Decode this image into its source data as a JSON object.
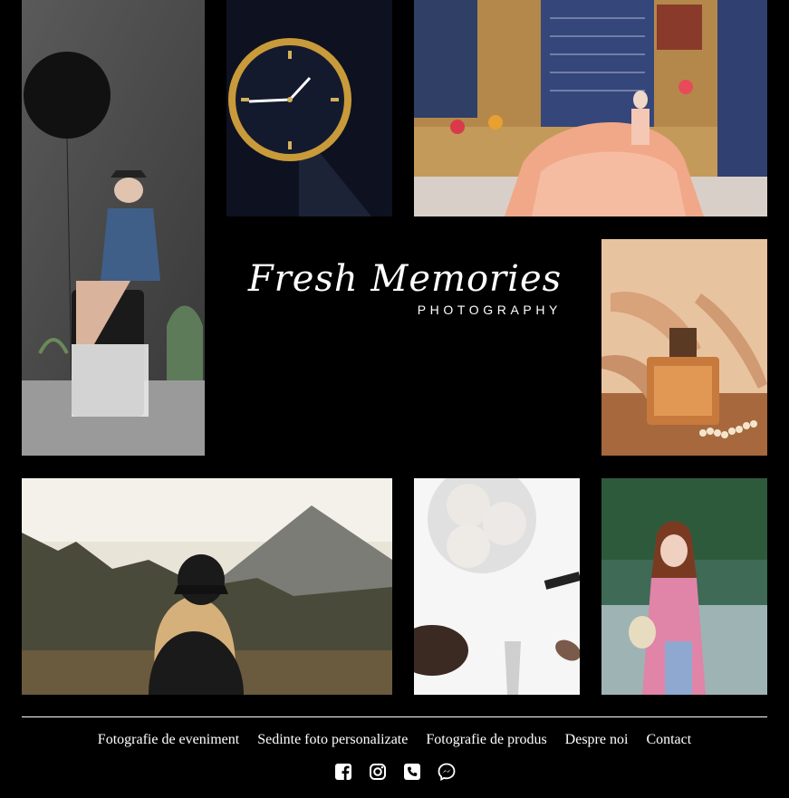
{
  "brand": {
    "name": "Fresh Memories",
    "tagline": "PHOTOGRAPHY"
  },
  "gallery": [
    {
      "subject": "woman with black balloon sitting on stool"
    },
    {
      "subject": "gold wristwatch"
    },
    {
      "subject": "bride in peach ball gown"
    },
    {
      "subject": "perfume bottle with heels and pearls"
    },
    {
      "subject": "woman in cap facing mountains"
    },
    {
      "subject": "makeup brushes and powder"
    },
    {
      "subject": "woman in pink ao dai by lake"
    }
  ],
  "footer": {
    "nav": [
      "Fotografie de eveniment",
      "Sedinte foto personalizate",
      "Fotografie de produs",
      "Despre noi",
      "Contact"
    ],
    "social_icons": [
      "facebook-icon",
      "instagram-icon",
      "phone-icon",
      "messenger-icon"
    ]
  },
  "colors": {
    "background": "#000000",
    "text": "#ffffff"
  }
}
